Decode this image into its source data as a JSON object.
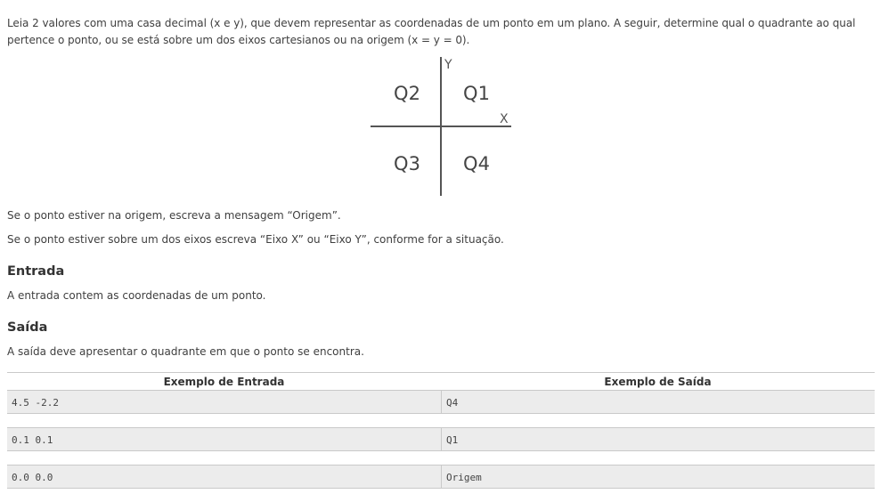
{
  "intro": {
    "text": "Leia 2 valores com uma casa decimal (x e y), que devem representar as coordenadas de um ponto em um plano. A seguir, determine qual o quadrante ao qual pertence o ponto, ou se está sobre um dos eixos cartesianos ou na origem (x = y = 0)."
  },
  "figure": {
    "y_axis_label": "Y",
    "x_axis_label": "X",
    "q1": "Q1",
    "q2": "Q2",
    "q3": "Q3",
    "q4": "Q4"
  },
  "rules": {
    "origin": "Se o ponto estiver na origem, escreva a mensagem “Origem”.",
    "axis": "Se o ponto estiver sobre um dos eixos escreva “Eixo X” ou “Eixo Y”, conforme for a situação."
  },
  "input_section": {
    "title": "Entrada",
    "text": "A entrada contem as coordenadas de um ponto."
  },
  "output_section": {
    "title": "Saída",
    "text": "A saída deve apresentar o quadrante em que o ponto se encontra."
  },
  "examples": {
    "input_header": "Exemplo de Entrada",
    "output_header": "Exemplo de Saída",
    "rows": [
      {
        "input": "4.5 -2.2",
        "output": "Q4"
      },
      {
        "input": "0.1 0.1",
        "output": "Q1"
      },
      {
        "input": "0.0 0.0",
        "output": "Origem"
      }
    ]
  }
}
